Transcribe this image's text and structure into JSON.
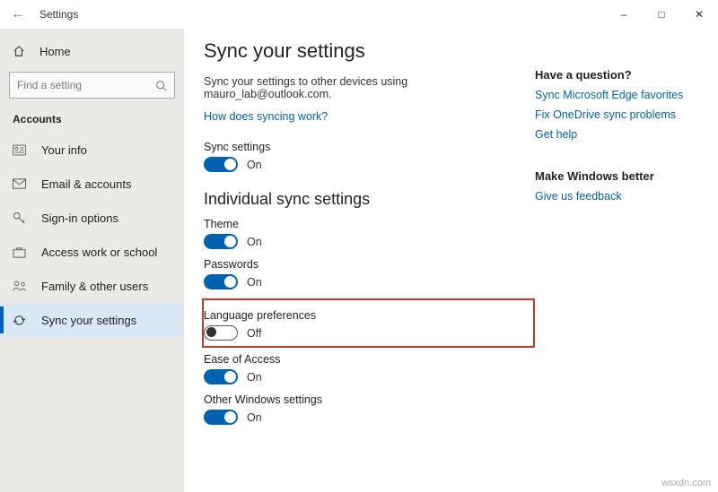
{
  "window": {
    "title": "Settings"
  },
  "sidebar": {
    "home": "Home",
    "search_placeholder": "Find a setting",
    "section": "Accounts",
    "items": [
      {
        "icon": "id",
        "label": "Your info"
      },
      {
        "icon": "mail",
        "label": "Email & accounts"
      },
      {
        "icon": "key",
        "label": "Sign-in options"
      },
      {
        "icon": "briefcase",
        "label": "Access work or school"
      },
      {
        "icon": "family",
        "label": "Family & other users"
      },
      {
        "icon": "sync",
        "label": "Sync your settings"
      }
    ]
  },
  "page": {
    "title": "Sync your settings",
    "desc": "Sync your settings to other devices using mauro_lab@outlook.com.",
    "how_link": "How does syncing work?",
    "sync_label": "Sync settings",
    "on": "On",
    "off": "Off",
    "section2": "Individual sync settings",
    "settings": {
      "theme": "Theme",
      "passwords": "Passwords",
      "language": "Language preferences",
      "ease": "Ease of Access",
      "other": "Other Windows settings"
    }
  },
  "aside": {
    "q_head": "Have a question?",
    "links": [
      "Sync Microsoft Edge favorites",
      "Fix OneDrive sync problems",
      "Get help"
    ],
    "better_head": "Make Windows better",
    "feedback": "Give us feedback"
  },
  "watermark": "wsxdn.com"
}
